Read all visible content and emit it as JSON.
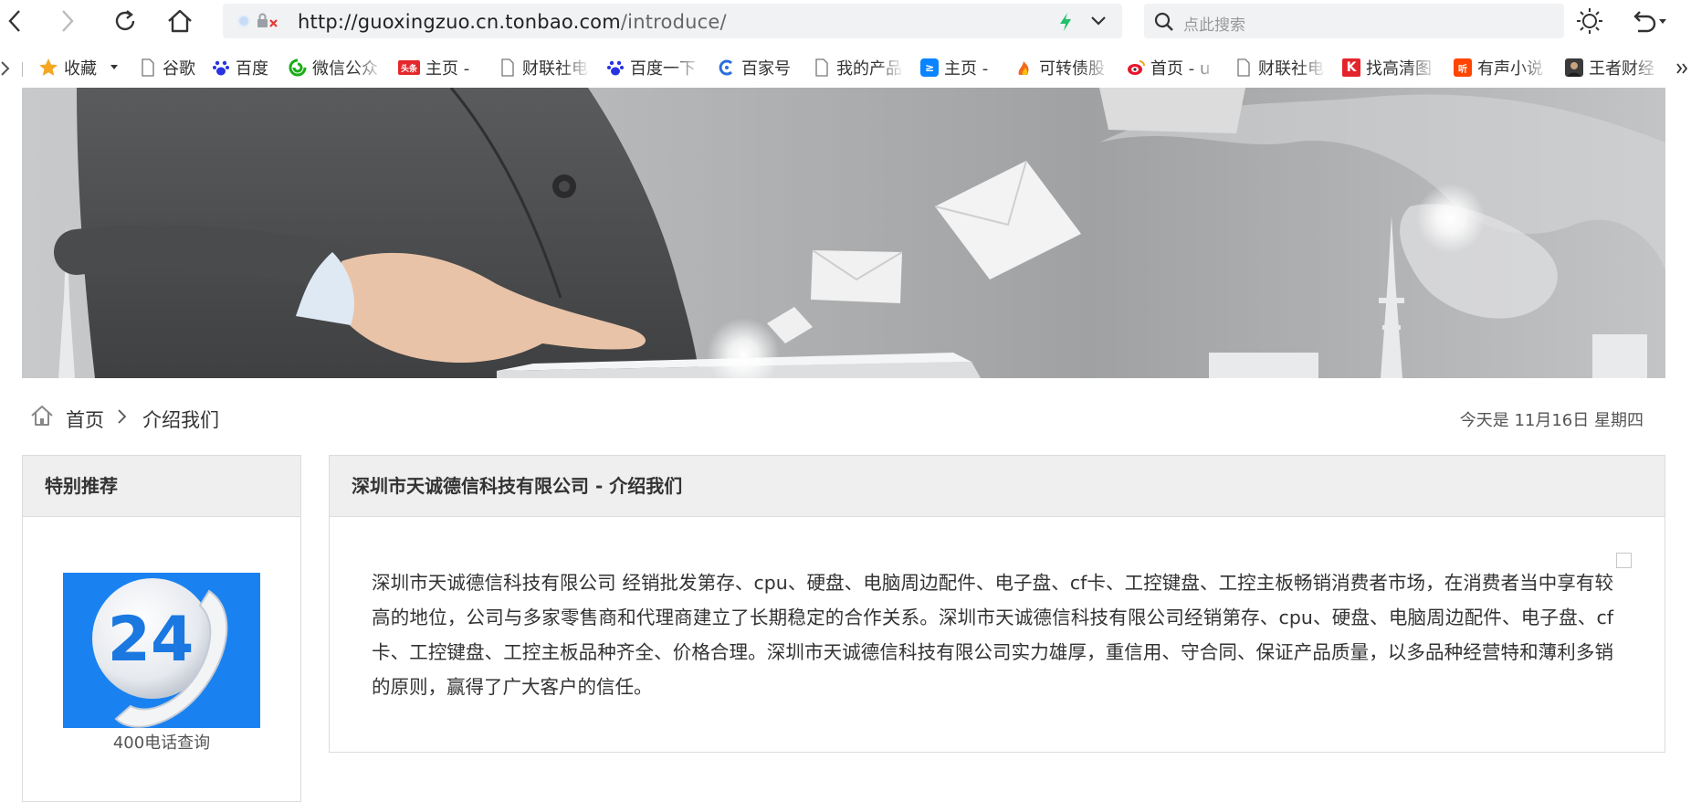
{
  "browser": {
    "url": "http://guoxingzuo.cn.tonbao.com/introduce/",
    "url_host": "http://guoxingzuo.cn.tonbao.com",
    "url_path": "/introduce/",
    "search_placeholder": "点此搜索"
  },
  "bookmarks": [
    {
      "label": "收藏",
      "icon": "star-icon"
    },
    {
      "label": "谷歌",
      "icon": "page-icon"
    },
    {
      "label": "百度",
      "icon": "baidu-paw-icon"
    },
    {
      "label": "微信公众",
      "icon": "wechat-icon"
    },
    {
      "label": "主页 -",
      "icon": "toutiao-icon",
      "icon_text": "头条"
    },
    {
      "label": "财联社电",
      "icon": "page-icon"
    },
    {
      "label": "百度一下",
      "icon": "baidu-paw-icon"
    },
    {
      "label": "百家号",
      "icon": "baijiahao-icon"
    },
    {
      "label": "我的产品",
      "icon": "page-icon"
    },
    {
      "label": "主页 -",
      "icon": "zhihu-icon"
    },
    {
      "label": "可转债股",
      "icon": "flame-icon"
    },
    {
      "label": "首页 - u",
      "icon": "weibo-icon"
    },
    {
      "label": "财联社电",
      "icon": "page-icon"
    },
    {
      "label": "找高清图",
      "icon": "k-logo-icon"
    },
    {
      "label": "有声小说",
      "icon": "ting-icon"
    },
    {
      "label": "王者财经",
      "icon": "avatar-icon"
    }
  ],
  "breadcrumb": {
    "home": "首页",
    "current": "介绍我们"
  },
  "today": "今天是 11月16日 星期四",
  "sidebar": {
    "title": "特别推荐",
    "ad_number": "24",
    "ad_caption": "400电话查询"
  },
  "main": {
    "title": "深圳市天诚德信科技有限公司 - 介绍我们",
    "body": "深圳市天诚德信科技有限公司 经销批发第存、cpu、硬盘、电脑周边配件、电子盘、cf卡、工控键盘、工控主板畅销消费者市场，在消费者当中享有较高的地位，公司与多家零售商和代理商建立了长期稳定的合作关系。深圳市天诚德信科技有限公司经销第存、cpu、硬盘、电脑周边配件、电子盘、cf卡、工控键盘、工控主板品种齐全、价格合理。深圳市天诚德信科技有限公司实力雄厚，重信用、守合同、保证产品质量，以多品种经营特和薄利多销的原则，赢得了广大客户的信任。"
  },
  "colors": {
    "accent_blue": "#1a82f0",
    "panel_header": "#efefef",
    "border": "#dcdcdc"
  }
}
